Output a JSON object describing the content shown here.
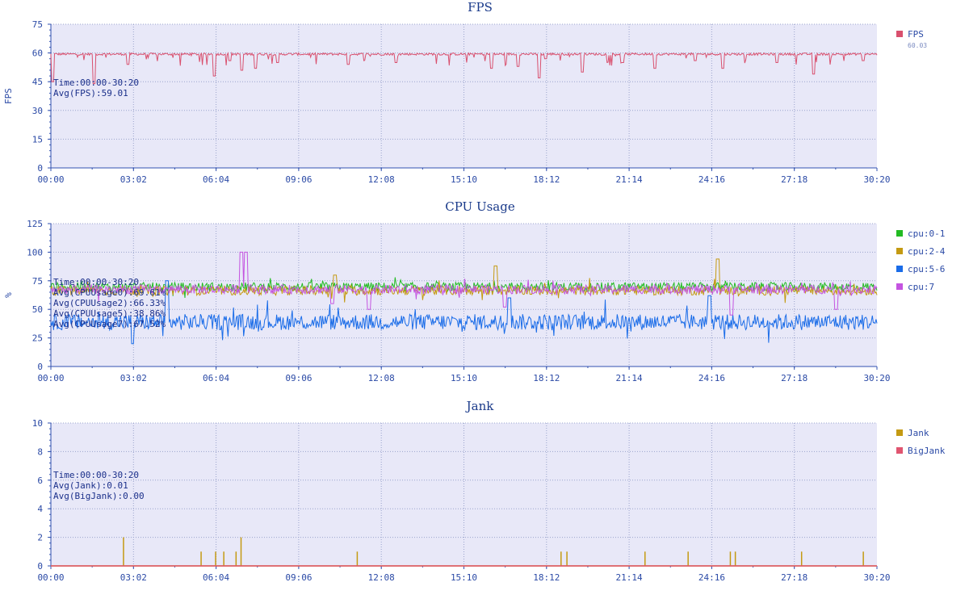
{
  "chart_data": [
    {
      "type": "line",
      "id": "fps",
      "title": "FPS",
      "ylabel": "FPS",
      "ylim": [
        0,
        75
      ],
      "yticks": [
        0,
        15,
        30,
        45,
        60,
        75
      ],
      "xlim_seconds": [
        0,
        1820
      ],
      "xtick_labels": [
        "00:00",
        "03:02",
        "06:04",
        "09:06",
        "12:08",
        "15:10",
        "18:12",
        "21:14",
        "24:16",
        "27:18",
        "30:20"
      ],
      "grid": true,
      "legend_position": "right",
      "annotations": [
        "Time:00:00-30:20",
        "Avg(FPS):59.01"
      ],
      "series": [
        {
          "name": "FPS",
          "sublabel": "60.03",
          "color": "#d9506e",
          "baseline": 59.4,
          "dips": [
            [
              5,
              45
            ],
            [
              95,
              44
            ],
            [
              170,
              54
            ],
            [
              360,
              48
            ],
            [
              395,
              56
            ],
            [
              420,
              51
            ],
            [
              450,
              52
            ],
            [
              500,
              55
            ],
            [
              655,
              54
            ],
            [
              760,
              55
            ],
            [
              970,
              52
            ],
            [
              1030,
              53
            ],
            [
              1075,
              47
            ],
            [
              1090,
              57
            ],
            [
              1170,
              50
            ],
            [
              1260,
              55
            ],
            [
              1330,
              52
            ],
            [
              1420,
              56
            ],
            [
              1480,
              52
            ],
            [
              1600,
              55
            ],
            [
              1680,
              49
            ],
            [
              1790,
              56
            ]
          ]
        }
      ]
    },
    {
      "type": "line",
      "id": "cpu",
      "title": "CPU Usage",
      "ylabel": "%",
      "ylim": [
        0,
        125
      ],
      "yticks": [
        0,
        25,
        50,
        75,
        100,
        125
      ],
      "xlim_seconds": [
        0,
        1820
      ],
      "xtick_labels": [
        "00:00",
        "03:02",
        "06:04",
        "09:06",
        "12:08",
        "15:10",
        "18:12",
        "21:14",
        "24:16",
        "27:18",
        "30:20"
      ],
      "grid": true,
      "legend_position": "right",
      "annotations": [
        "Time:00:00-30:20",
        "Avg(CPUUsage0):69.61%",
        "Avg(CPUUsage2):66.33%",
        "Avg(CPUUsage5):38.86%",
        "Avg(CPUUsage7):67.52%"
      ],
      "series": [
        {
          "name": "cpu:0-1",
          "color": "#22bb22",
          "mean": 69.6,
          "noise": 4
        },
        {
          "name": "cpu:2-4",
          "color": "#c49a12",
          "mean": 66.3,
          "noise": 4,
          "spikes": [
            [
              625,
              80
            ],
            [
              980,
              88
            ],
            [
              1470,
              94
            ]
          ]
        },
        {
          "name": "cpu:5-6",
          "color": "#1a6ce8",
          "mean": 38.9,
          "noise": 7,
          "spikes": [
            [
              180,
              20
            ],
            [
              255,
              75
            ],
            [
              1010,
              60
            ],
            [
              1450,
              62
            ]
          ]
        },
        {
          "name": "cpu:7",
          "color": "#c454e0",
          "mean": 67.5,
          "noise": 4,
          "spikes": [
            [
              420,
              100
            ],
            [
              430,
              100
            ],
            [
              620,
              55
            ],
            [
              700,
              50
            ],
            [
              1000,
              52
            ],
            [
              1500,
              45
            ],
            [
              1730,
              50
            ]
          ]
        }
      ]
    },
    {
      "type": "bar",
      "id": "jank",
      "title": "Jank",
      "ylabel": "",
      "ylim": [
        0,
        10
      ],
      "yticks": [
        0,
        2,
        4,
        6,
        8,
        10
      ],
      "xlim_seconds": [
        0,
        1820
      ],
      "xtick_labels": [
        "00:00",
        "03:02",
        "06:04",
        "09:06",
        "12:08",
        "15:10",
        "18:12",
        "21:14",
        "24:16",
        "27:18",
        "30:20"
      ],
      "grid": true,
      "legend_position": "right",
      "annotations": [
        "Time:00:00-30:20",
        "Avg(Jank):0.01",
        "Avg(BigJank):0.00"
      ],
      "series": [
        {
          "name": "Jank",
          "color": "#c49a12",
          "events": [
            [
              160,
              2
            ],
            [
              331,
              1
            ],
            [
              363,
              1
            ],
            [
              381,
              1
            ],
            [
              408,
              1
            ],
            [
              419,
              2
            ],
            [
              675,
              1
            ],
            [
              1124,
              1
            ],
            [
              1137,
              1
            ],
            [
              1309,
              1
            ],
            [
              1404,
              1
            ],
            [
              1497,
              1
            ],
            [
              1508,
              1
            ],
            [
              1654,
              1
            ],
            [
              1790,
              1
            ]
          ]
        },
        {
          "name": "BigJank",
          "color": "#e05570",
          "events": []
        }
      ]
    }
  ]
}
